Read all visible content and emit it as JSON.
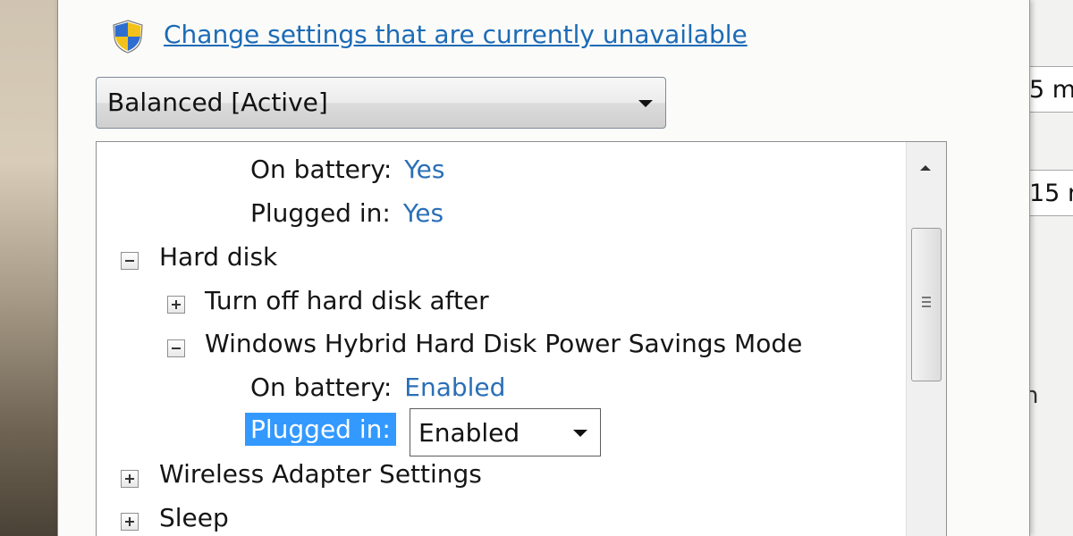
{
  "top_fragment": "[ ]",
  "change_link": "Change settings that are currently unavailable",
  "plan_select": {
    "value": "Balanced [Active]"
  },
  "tree": {
    "prev_on_battery": {
      "label": "On battery:",
      "value": "Yes"
    },
    "prev_plugged_in": {
      "label": "Plugged in:",
      "value": "Yes"
    },
    "hard_disk": "Hard disk",
    "turn_off_hard_disk": "Turn off hard disk after",
    "hybrid_mode": "Windows Hybrid Hard Disk Power Savings Mode",
    "hybrid_on_battery": {
      "label": "On battery:",
      "value": "Enabled"
    },
    "hybrid_plugged_in": {
      "label": "Plugged in:",
      "value": "Enabled"
    },
    "wireless": "Wireless Adapter Settings",
    "sleep": "Sleep"
  },
  "right_window": {
    "field1": "5 m",
    "field2": "15 m",
    "fragment": "n"
  },
  "colors": {
    "link": "#1c6bb6",
    "value_text": "#2a6fb7",
    "selection": "#3399ff"
  },
  "icons": {
    "shield": "uac-shield-icon",
    "dropdown": "chevron-down-icon",
    "expand": "plus-box-icon",
    "collapse": "minus-box-icon"
  }
}
